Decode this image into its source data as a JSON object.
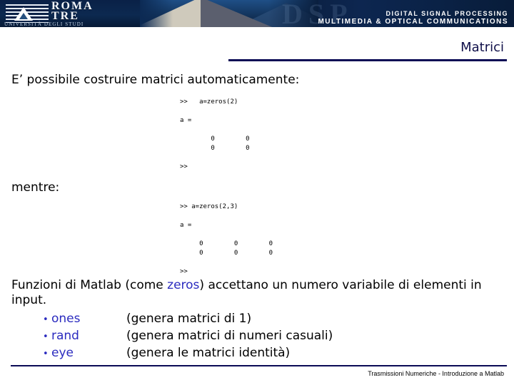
{
  "header": {
    "university_name_line1": "ROMA",
    "university_name_line2": "TRE",
    "university_subtitle": "UNIVERSITÀ DEGLI STUDI",
    "ghost_watermark": "DSP",
    "program_line1": "DIGITAL SIGNAL PROCESSING",
    "program_line2": "MULTIMEDIA & OPTICAL  COMMUNICATIONS"
  },
  "slide": {
    "title": "Matrici",
    "lead_text": "E’ possibile costruire matrici automaticamente:",
    "mentre_text": "mentre:"
  },
  "console_block_1": ">>   a=zeros(2)\n\na =\n\n        0        0\n        0        0\n\n>>",
  "console_block_2": ">> a=zeros(2,3)\n\na =\n\n     0        0        0\n     0        0        0\n\n>>",
  "closing": {
    "part1": "Funzioni di Matlab (come ",
    "keyword": "zeros",
    "part2": ") accettano un numero variabile di elementi in input."
  },
  "bullets": [
    {
      "marker": "•",
      "name": "ones",
      "desc": "(genera matrici di 1)"
    },
    {
      "marker": "•",
      "name": "rand",
      "desc": "(genera matrici di numeri casuali)"
    },
    {
      "marker": "•",
      "name": "eye",
      "desc": "(genera le matrici identità)"
    }
  ],
  "footer": {
    "text": "Trasmissioni Numeriche - Introduzione a Matlab"
  },
  "colors": {
    "title_navy": "#10104a",
    "rule_navy": "#0a0a55",
    "keyword_blue": "#2b2bbf",
    "banner_blue": "#0d2a52"
  }
}
